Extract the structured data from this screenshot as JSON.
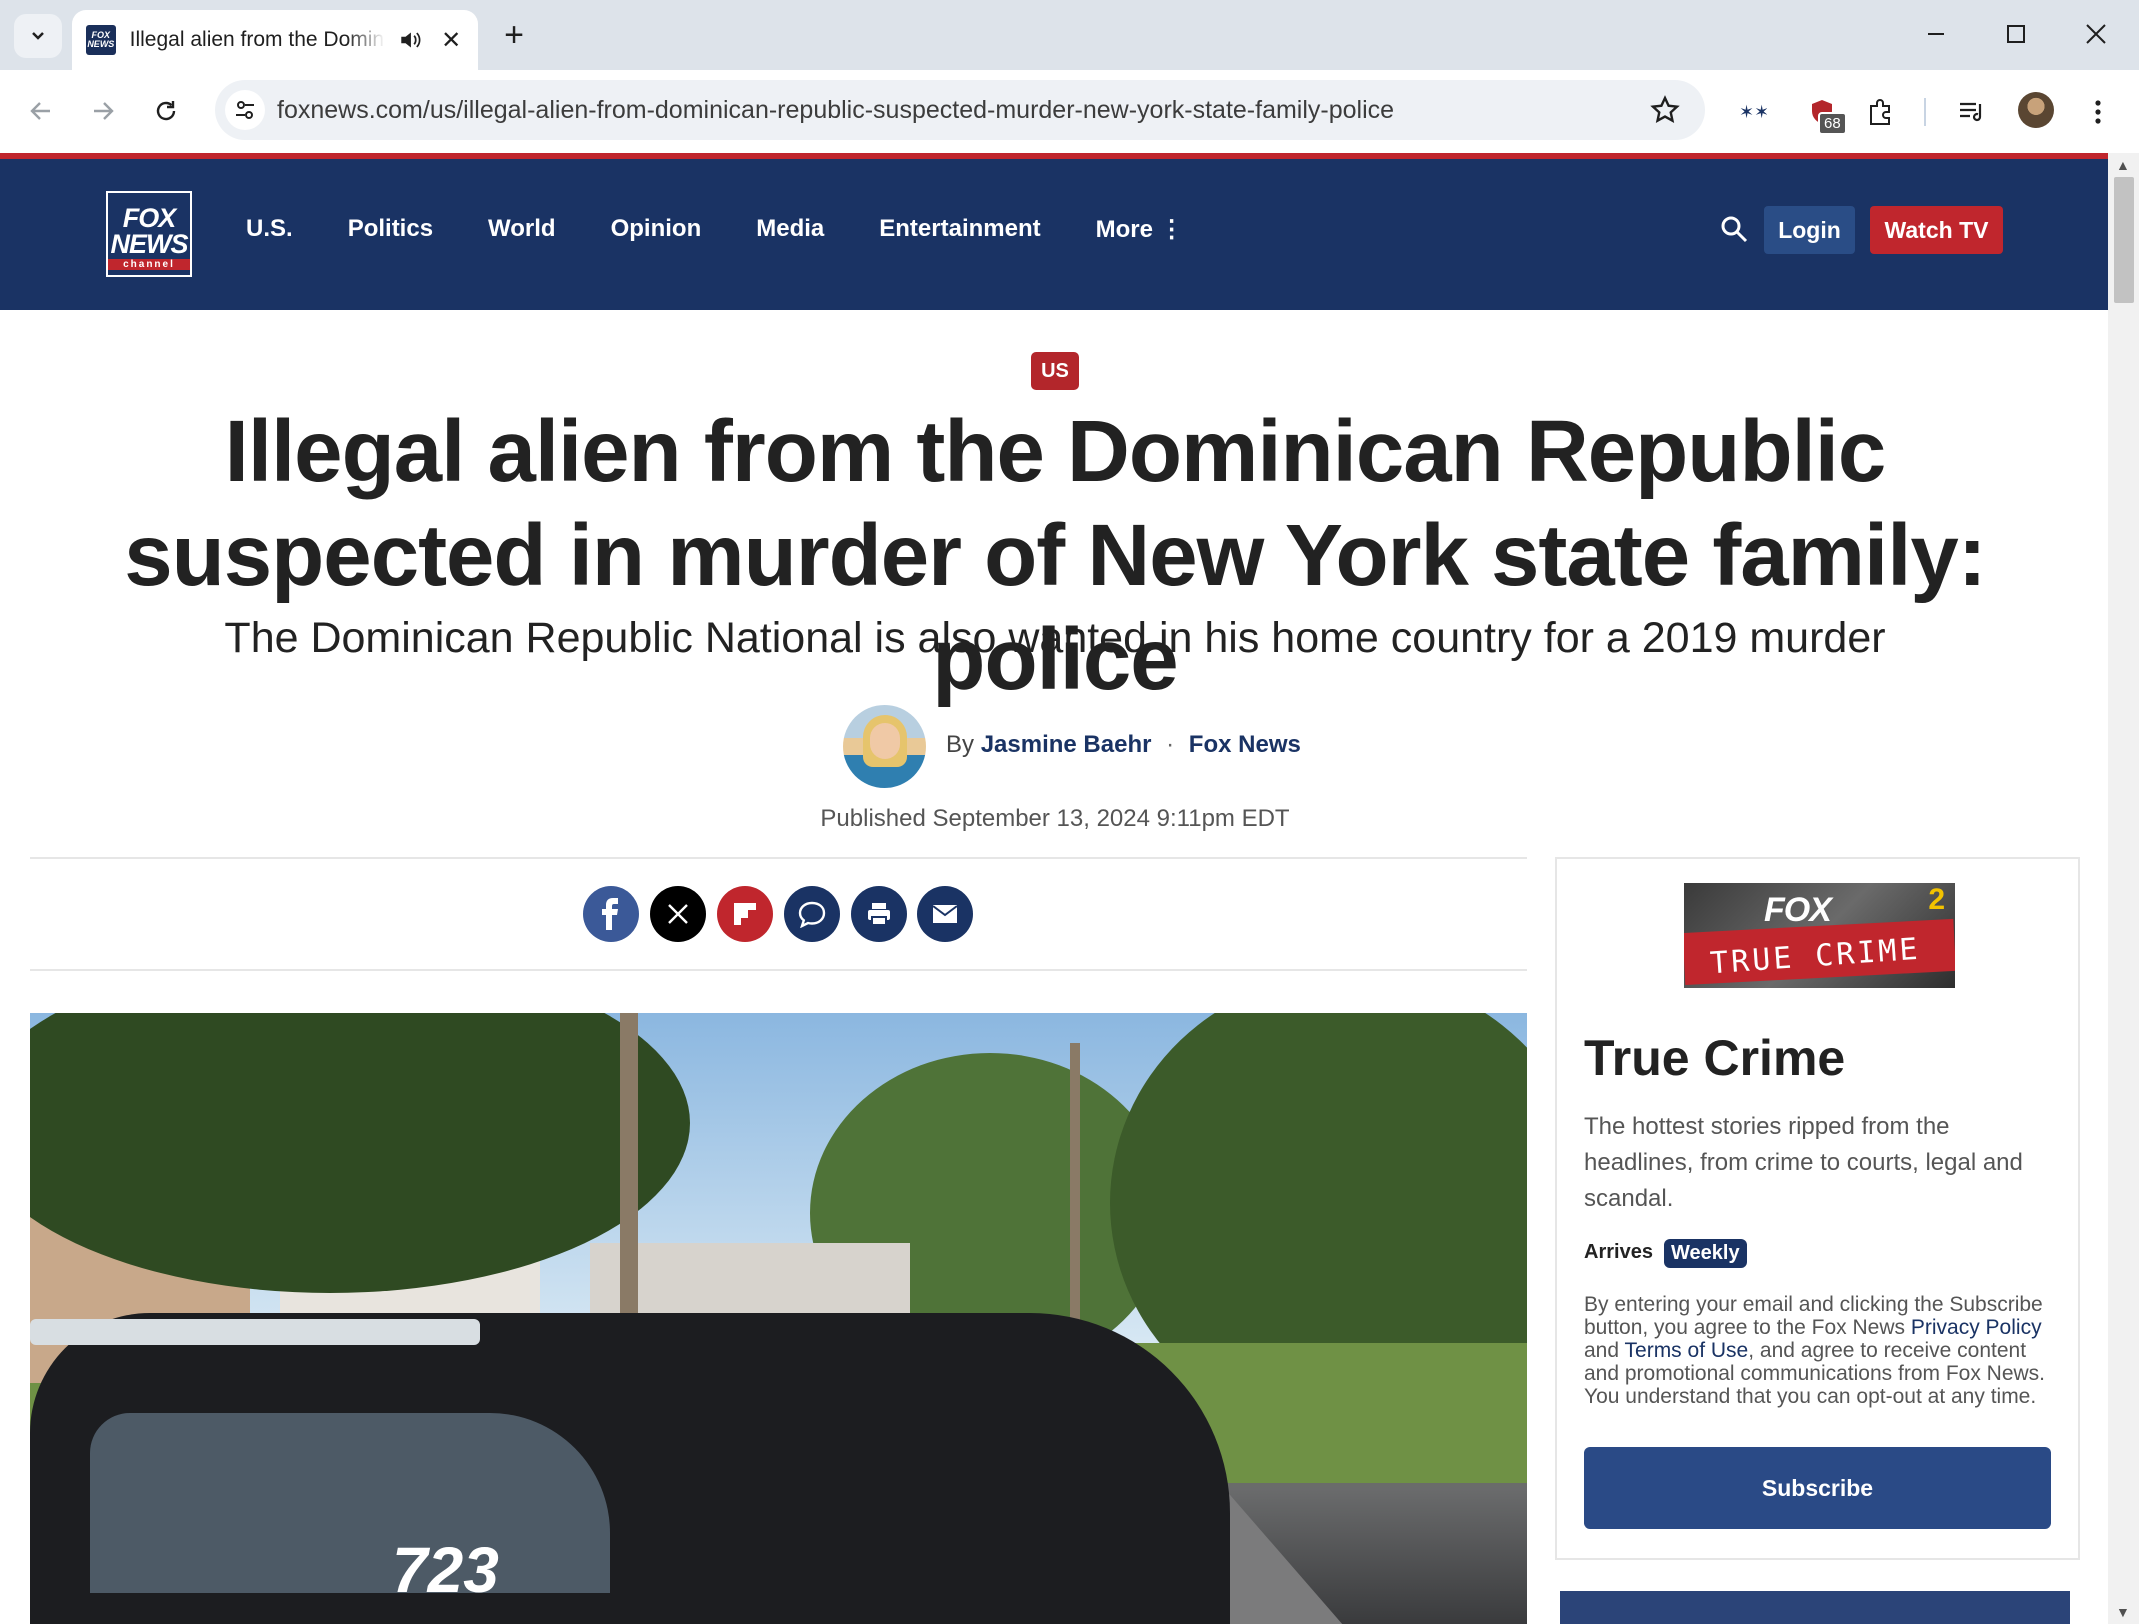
{
  "browser": {
    "tab": {
      "title": "Illegal alien from the Dominican Republic suspected in murder of New York state family: police",
      "favicon": "fox-news-favicon"
    },
    "url": "foxnews.com/us/illegal-alien-from-dominican-republic-suspected-murder-new-york-state-family-police",
    "extension_badge": "68"
  },
  "site": {
    "logo": {
      "line1": "FOX",
      "line2": "NEWS",
      "line3": "channel"
    },
    "nav": [
      "U.S.",
      "Politics",
      "World",
      "Opinion",
      "Media",
      "Entertainment",
      "More ⋮"
    ],
    "login": "Login",
    "watch_tv": "Watch TV",
    "colors": {
      "nav_bg": "#1a3364",
      "accent_red": "#c0262d"
    }
  },
  "article": {
    "category": "US",
    "headline": "Illegal alien from the Dominican Republic suspected in murder of New York state family: police",
    "subhead": "The Dominican Republic National is also wanted in his home country for a 2019 murder",
    "by": "By",
    "author": "Jasmine Baehr",
    "outlet": "Fox News",
    "published": "Published September 13, 2024 9:11pm EDT",
    "hero_unit_number": "723"
  },
  "sidebar": {
    "logo_brand": "FOX",
    "logo_text": "TRUE CRIME",
    "logo_badge": "2",
    "title": "True Crime",
    "description": "The hottest stories ripped from the headlines, from crime to courts, legal and scandal.",
    "arrives_label": "Arrives",
    "frequency": "Weekly",
    "legal_1": "By entering your email and clicking the Subscribe button, you agree to the Fox News",
    "privacy": "Privacy Policy",
    "and": "and",
    "terms": "Terms of Use",
    "legal_2": ", and agree to receive content and promotional communications from Fox News. You understand that you can opt-out at any time.",
    "subscribe": "Subscribe"
  }
}
